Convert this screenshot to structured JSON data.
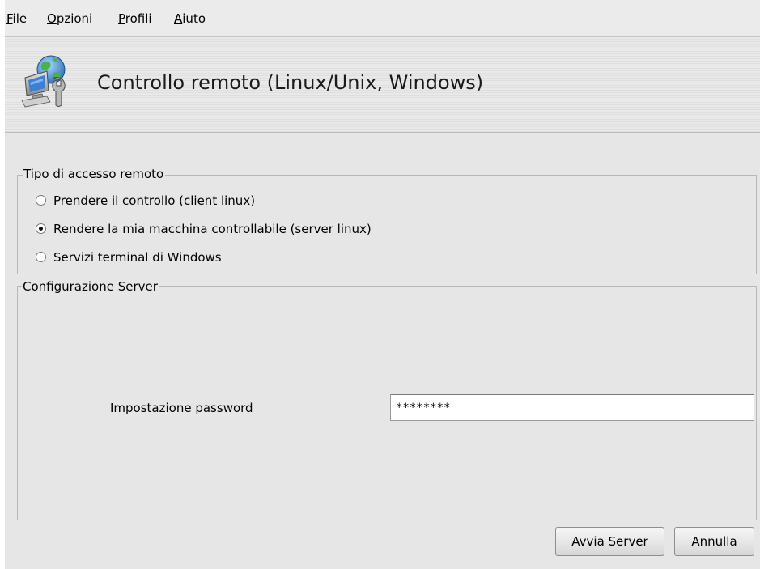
{
  "menubar": {
    "items": [
      {
        "mnemonic": "F",
        "rest": "ile"
      },
      {
        "mnemonic": "O",
        "rest": "pzioni"
      },
      {
        "mnemonic": "P",
        "rest": "rofili"
      },
      {
        "mnemonic": "A",
        "rest": "iuto"
      }
    ]
  },
  "banner": {
    "icon": "remote-control-computer-icon",
    "title": "Controllo remoto (Linux/Unix, Windows)"
  },
  "access_type": {
    "legend": "Tipo di accesso remoto",
    "options": [
      {
        "label": "Prendere il controllo (client linux)",
        "checked": false
      },
      {
        "label": "Rendere la mia macchina controllabile (server linux)",
        "checked": true
      },
      {
        "label": "Servizi terminal di Windows",
        "checked": false
      }
    ]
  },
  "server_config": {
    "legend": "Configurazione Server",
    "password_label": "Impostazione password",
    "password_value": "********"
  },
  "buttons": {
    "start": "Avvia Server",
    "cancel": "Annulla"
  }
}
